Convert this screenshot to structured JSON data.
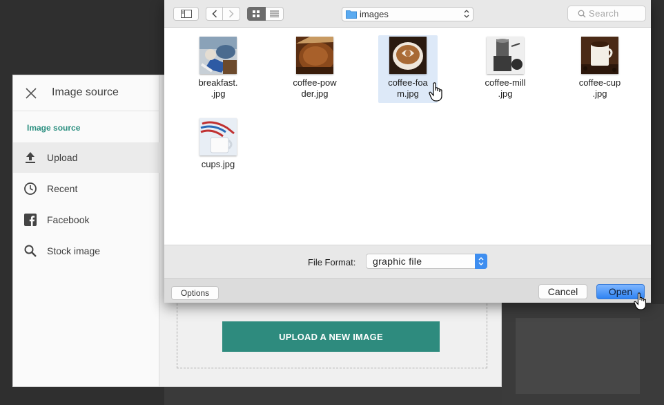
{
  "source_panel": {
    "title": "Image source",
    "section_label": "Image source",
    "nav": [
      {
        "label": "Upload",
        "icon": "upload-icon",
        "active": true
      },
      {
        "label": "Recent",
        "icon": "clock-icon",
        "active": false
      },
      {
        "label": "Facebook",
        "icon": "facebook-icon",
        "active": false
      },
      {
        "label": "Stock image",
        "icon": "search-icon",
        "active": false
      }
    ],
    "upload_button": "UPLOAD A NEW IMAGE",
    "accent_color": "#2e8b7e"
  },
  "dialog": {
    "location": "images",
    "search_placeholder": "Search",
    "view_mode": "icon",
    "files": [
      {
        "line1": "breakfast.",
        "line2": ".jpg",
        "selected": false
      },
      {
        "line1": "coffee-pow",
        "line2": "der.jpg",
        "selected": false
      },
      {
        "line1": "coffee-foa",
        "line2": "m.jpg",
        "selected": true
      },
      {
        "line1": "coffee-mill",
        "line2": ".jpg",
        "selected": false
      },
      {
        "line1": "coffee-cup",
        "line2": ".jpg",
        "selected": false
      },
      {
        "line1": "cups.jpg",
        "line2": "",
        "selected": false
      }
    ],
    "format_label": "File Format:",
    "format_value": "graphic file",
    "options_label": "Options",
    "cancel_label": "Cancel",
    "open_label": "Open"
  }
}
